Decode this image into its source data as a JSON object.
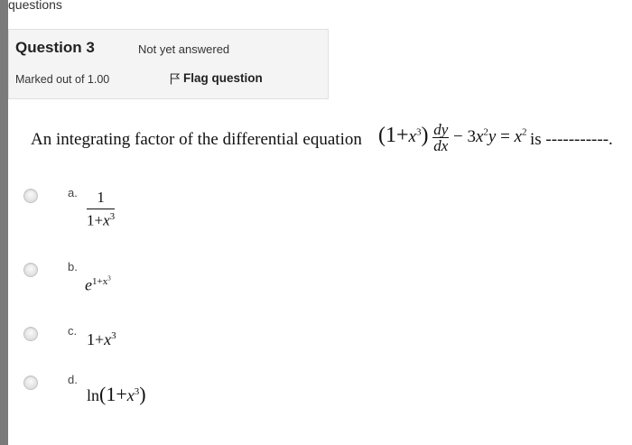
{
  "header": {
    "crumb": "questions"
  },
  "question": {
    "title": "Question 3",
    "status": "Not yet answered",
    "marks": "Marked out of 1.00",
    "flag_label": "Flag question",
    "text": "An integrating factor of the differential equation",
    "equation": {
      "lhs_paren_open": "(1+",
      "lhs_var": "x",
      "lhs_exp": "3",
      "lhs_paren_close": ")",
      "frac_num": "dy",
      "frac_den": "dx",
      "middle": "− 3",
      "middle_var": "x",
      "middle_exp": "2",
      "rhs_y": "y",
      "rhs_eq": " = ",
      "rhs_var": "x",
      "rhs_exp": "2"
    },
    "tail": "is -----------."
  },
  "options": [
    {
      "letter": "a.",
      "num": "1",
      "den_base": "1+",
      "den_var": "x",
      "den_exp": "3"
    },
    {
      "letter": "b.",
      "base": "e",
      "exp": "1+x",
      "exp_sup": "3"
    },
    {
      "letter": "c.",
      "base": "1+",
      "var": "x",
      "exp": "3"
    },
    {
      "letter": "d.",
      "fn": "ln",
      "open": "(1+",
      "var": "x",
      "exp": "3",
      "close": ")"
    }
  ],
  "icons": {
    "flag": "flag-icon",
    "radio": "radio-icon"
  }
}
